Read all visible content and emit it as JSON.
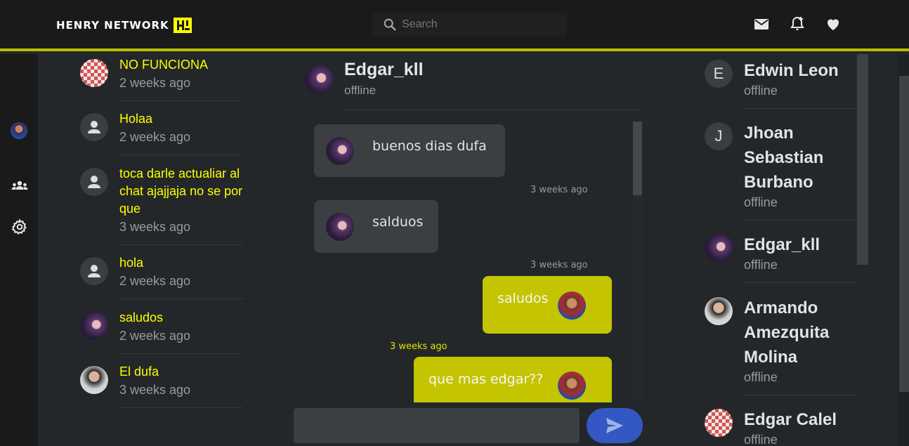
{
  "header": {
    "brand": "HENRY NETWORK",
    "search_placeholder": "Search",
    "icons": [
      "mail-icon",
      "bell-plus-icon",
      "heart-icon"
    ]
  },
  "sidebar": {
    "icons": [
      "user-avatar",
      "group-icon",
      "settings-icon"
    ]
  },
  "conversations": [
    {
      "name": "NO FUNCIONA",
      "time": "2 weeks ago",
      "avatar": "checker-avatar"
    },
    {
      "name": "Holaa",
      "time": "2 weeks ago",
      "avatar": "person-icon"
    },
    {
      "name": "toca darle actualiar al chat ajajjaja no se por que",
      "time": "3 weeks ago",
      "avatar": "person-icon"
    },
    {
      "name": "hola",
      "time": "2 weeks ago",
      "avatar": "person-icon"
    },
    {
      "name": "saludos",
      "time": "2 weeks ago",
      "avatar": "photo-avatar"
    },
    {
      "name": "El dufa",
      "time": "3 weeks ago",
      "avatar": "photo-avatar"
    }
  ],
  "chat": {
    "name": "Edgar_kll",
    "status": "offline",
    "messages": [
      {
        "text": "buenos dias dufa",
        "direction": "incoming",
        "time": "3 weeks ago"
      },
      {
        "text": "salduos",
        "direction": "incoming",
        "time": "3 weeks ago"
      },
      {
        "text": "saludos",
        "direction": "outgoing",
        "time": "3 weeks ago"
      },
      {
        "text": "que mas edgar??",
        "direction": "outgoing",
        "time": ""
      }
    ],
    "input_value": ""
  },
  "contacts": [
    {
      "initial": "E",
      "name": "Edwin Leon",
      "status": "offline"
    },
    {
      "initial": "J",
      "name": "Jhoan Sebastian Burbano",
      "status": "offline"
    },
    {
      "initial": "",
      "name": "Edgar_kll",
      "status": "offline"
    },
    {
      "initial": "",
      "name": "Armando Amezquita Molina",
      "status": "offline"
    },
    {
      "initial": "",
      "name": "Edgar Calel",
      "status": "offline"
    }
  ],
  "colors": {
    "accent": "#ffff00",
    "header_bg": "#1a1a1a",
    "outgoing_bubble": "#c4c400",
    "incoming_bubble": "#3b3f42",
    "send_button": "#3358c4"
  }
}
